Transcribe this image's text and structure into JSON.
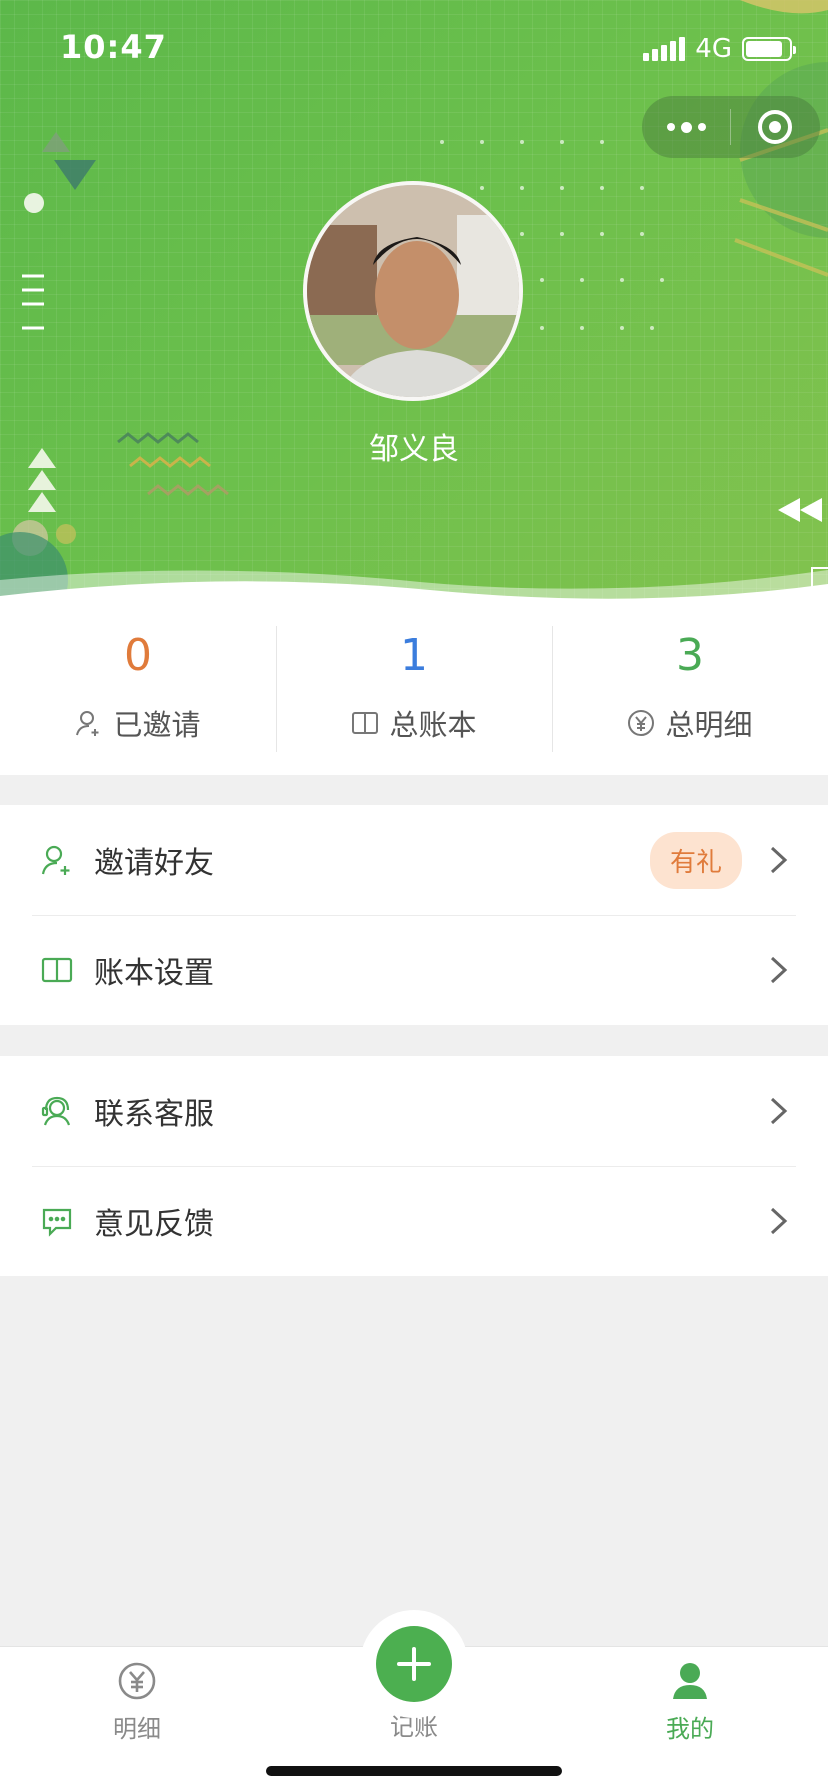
{
  "status_bar": {
    "time": "10:47",
    "network": "4G",
    "battery_level": 0.85
  },
  "profile": {
    "name": "邹义良"
  },
  "stats": [
    {
      "value": "0",
      "label": "已邀请",
      "color": "#e07b3b",
      "icon": "user-plus-icon"
    },
    {
      "value": "1",
      "label": "总账本",
      "color": "#3b7ddd",
      "icon": "book-icon"
    },
    {
      "value": "3",
      "label": "总明细",
      "color": "#4aaa55",
      "icon": "yen-circle-icon"
    }
  ],
  "menu_group_1": [
    {
      "label": "邀请好友",
      "badge": "有礼",
      "icon": "user-plus-icon"
    },
    {
      "label": "账本设置",
      "icon": "book-icon"
    }
  ],
  "menu_group_2": [
    {
      "label": "联系客服",
      "icon": "headset-icon"
    },
    {
      "label": "意见反馈",
      "icon": "message-icon"
    }
  ],
  "tabbar": {
    "left": {
      "label": "明细",
      "icon": "yen-circle-icon"
    },
    "center": {
      "label": "记账",
      "icon": "plus-icon"
    },
    "right": {
      "label": "我的",
      "icon": "person-icon",
      "active": true
    }
  },
  "colors": {
    "accent_green": "#4aaa55",
    "orange": "#e07b3b",
    "blue": "#3b7ddd"
  }
}
